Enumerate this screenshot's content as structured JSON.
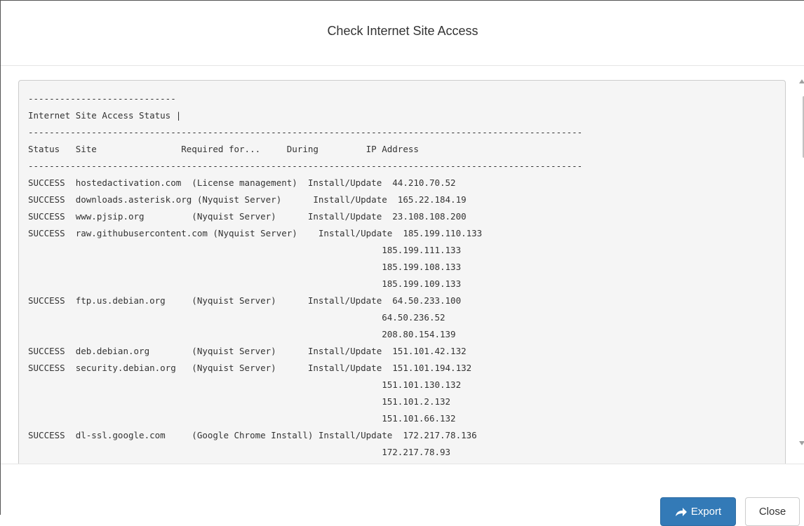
{
  "dialog": {
    "title": "Check Internet Site Access"
  },
  "report": {
    "text": "----------------------------\nInternet Site Access Status |\n---------------------------------------------------------------------------------------------------------\nStatus   Site                Required for...     During         IP Address\n---------------------------------------------------------------------------------------------------------\nSUCCESS  hostedactivation.com  (License management)  Install/Update  44.210.70.52\nSUCCESS  downloads.asterisk.org (Nyquist Server)      Install/Update  165.22.184.19\nSUCCESS  www.pjsip.org         (Nyquist Server)      Install/Update  23.108.108.200\nSUCCESS  raw.githubusercontent.com (Nyquist Server)    Install/Update  185.199.110.133\n                                                                   185.199.111.133\n                                                                   185.199.108.133\n                                                                   185.199.109.133\nSUCCESS  ftp.us.debian.org     (Nyquist Server)      Install/Update  64.50.233.100\n                                                                   64.50.236.52\n                                                                   208.80.154.139\nSUCCESS  deb.debian.org        (Nyquist Server)      Install/Update  151.101.42.132\nSUCCESS  security.debian.org   (Nyquist Server)      Install/Update  151.101.194.132\n                                                                   151.101.130.132\n                                                                   151.101.2.132\n                                                                   151.101.66.132\nSUCCESS  dl-ssl.google.com     (Google Chrome Install) Install/Update  172.217.78.136\n                                                                   172.217.78.93"
  },
  "footer": {
    "export_label": "Export",
    "close_label": "Close"
  },
  "colors": {
    "primary": "#337ab7",
    "pre_background": "#f5f5f5"
  },
  "icons": {
    "export": "share-arrow-icon"
  }
}
